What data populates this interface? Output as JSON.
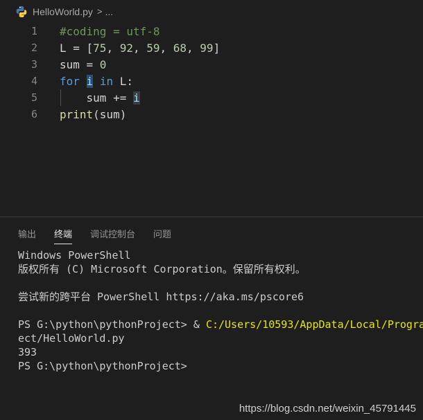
{
  "breadcrumb": {
    "file": "HelloWorld.py",
    "separator": ">",
    "more": "..."
  },
  "editor": {
    "lines": [
      {
        "number": "1",
        "text": "#coding = utf-8"
      },
      {
        "number": "2",
        "text": "L = [75, 92, 59, 68, 99]"
      },
      {
        "number": "3",
        "text": "sum = 0"
      },
      {
        "number": "4",
        "text": "for i in L:"
      },
      {
        "number": "5",
        "text": "    sum += i"
      },
      {
        "number": "6",
        "text": "print(sum)"
      }
    ]
  },
  "panel": {
    "tabs": [
      {
        "label": "输出",
        "active": false
      },
      {
        "label": "终端",
        "active": true
      },
      {
        "label": "调试控制台",
        "active": false
      },
      {
        "label": "问题",
        "active": false
      }
    ],
    "terminal": {
      "line1": "Windows PowerShell",
      "line2": "版权所有 (C) Microsoft Corporation。保留所有权利。",
      "line3": "",
      "line4": "尝试新的跨平台 PowerShell https://aka.ms/pscore6",
      "line5": "",
      "line6_prompt": "PS G:\\python\\pythonProject> ",
      "line6_op": "& ",
      "line6_path": "C:/Users/10593/AppData/Local/Progra",
      "line7": "ect/HelloWorld.py",
      "line8": "393",
      "line9": "PS G:\\python\\pythonProject>"
    }
  },
  "watermark": "https://blog.csdn.net/weixin_45791445",
  "colors": {
    "background": "#1e1e1e",
    "keyword": "#569cd6",
    "comment": "#6a9955",
    "number": "#b5cea8",
    "function": "#dcdcaa",
    "path_yellow": "#e5e510"
  }
}
